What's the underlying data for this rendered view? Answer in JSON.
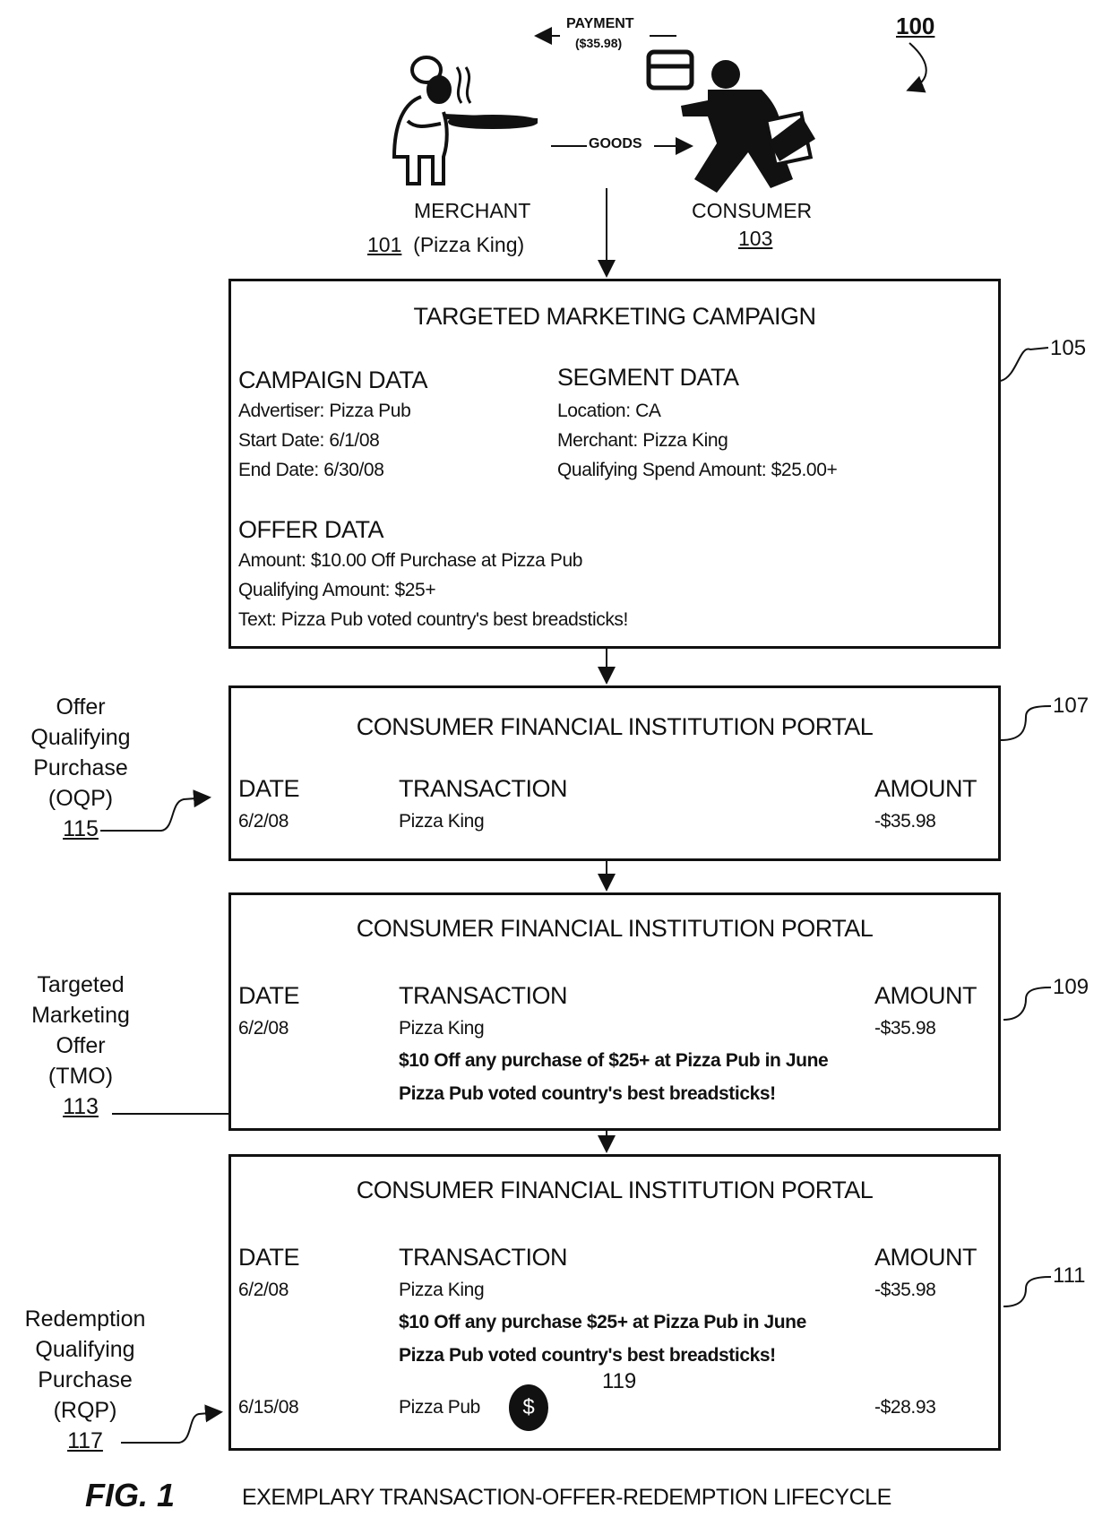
{
  "figure": {
    "ref_number": "100",
    "caption_fig": "FIG. 1",
    "caption_text": "EXEMPLARY TRANSACTION-OFFER-REDEMPTION LIFECYCLE"
  },
  "top": {
    "payment_label": "PAYMENT",
    "payment_amount": "($35.98)",
    "goods_label": "GOODS",
    "merchant": {
      "label": "MERCHANT",
      "ref": "101",
      "name": "(Pizza King)"
    },
    "consumer": {
      "label": "CONSUMER",
      "ref": "103"
    }
  },
  "campaign": {
    "ref": "105",
    "title": "TARGETED MARKETING CAMPAIGN",
    "campaign_data": {
      "heading": "CAMPAIGN DATA",
      "lines": [
        "Advertiser:  Pizza Pub",
        "Start Date:  6/1/08",
        "End Date: 6/30/08"
      ]
    },
    "segment_data": {
      "heading": "SEGMENT DATA",
      "lines": [
        "Location: CA",
        "Merchant: Pizza King",
        "Qualifying Spend Amount: $25.00+"
      ]
    },
    "offer_data": {
      "heading": "OFFER DATA",
      "lines": [
        "Amount: $10.00 Off Purchase at Pizza Pub",
        "Qualifying Amount:  $25+",
        "Text:  Pizza Pub voted country's best breadsticks!"
      ]
    }
  },
  "portals": [
    {
      "ref": "107",
      "title": "CONSUMER FINANCIAL INSTITUTION PORTAL",
      "headers": {
        "date": "DATE",
        "transaction": "TRANSACTION",
        "amount": "AMOUNT"
      },
      "rows": [
        {
          "date": "6/2/08",
          "transaction": "Pizza King",
          "amount": "-$35.98"
        }
      ]
    },
    {
      "ref": "109",
      "title": "CONSUMER FINANCIAL INSTITUTION PORTAL",
      "headers": {
        "date": "DATE",
        "transaction": "TRANSACTION",
        "amount": "AMOUNT"
      },
      "rows": [
        {
          "date": "6/2/08",
          "transaction": "Pizza King",
          "amount": "-$35.98"
        }
      ],
      "offer_lines": [
        "$10 Off any purchase of $25+ at Pizza Pub in June",
        "Pizza Pub voted country's best breadsticks!"
      ]
    },
    {
      "ref": "111",
      "title": "CONSUMER FINANCIAL INSTITUTION PORTAL",
      "headers": {
        "date": "DATE",
        "transaction": "TRANSACTION",
        "amount": "AMOUNT"
      },
      "rows": [
        {
          "date": "6/2/08",
          "transaction": "Pizza King",
          "amount": "-$35.98"
        },
        {
          "date": "6/15/08",
          "transaction": "Pizza Pub",
          "amount": "-$28.93"
        }
      ],
      "offer_lines": [
        "$10 Off any purchase $25+ at Pizza Pub in June",
        "Pizza Pub voted country's best breadsticks!"
      ],
      "redemption_icon": {
        "glyph": "$",
        "ref": "119"
      }
    }
  ],
  "side_labels": {
    "oqp": {
      "lines": [
        "Offer",
        "Qualifying",
        "Purchase",
        "(OQP)"
      ],
      "ref": "115"
    },
    "tmo": {
      "lines": [
        "Targeted",
        "Marketing",
        "Offer",
        "(TMO)"
      ],
      "ref": "113"
    },
    "rqp": {
      "lines": [
        "Redemption",
        "Qualifying",
        "Purchase",
        "(RQP)"
      ],
      "ref": "117"
    }
  }
}
